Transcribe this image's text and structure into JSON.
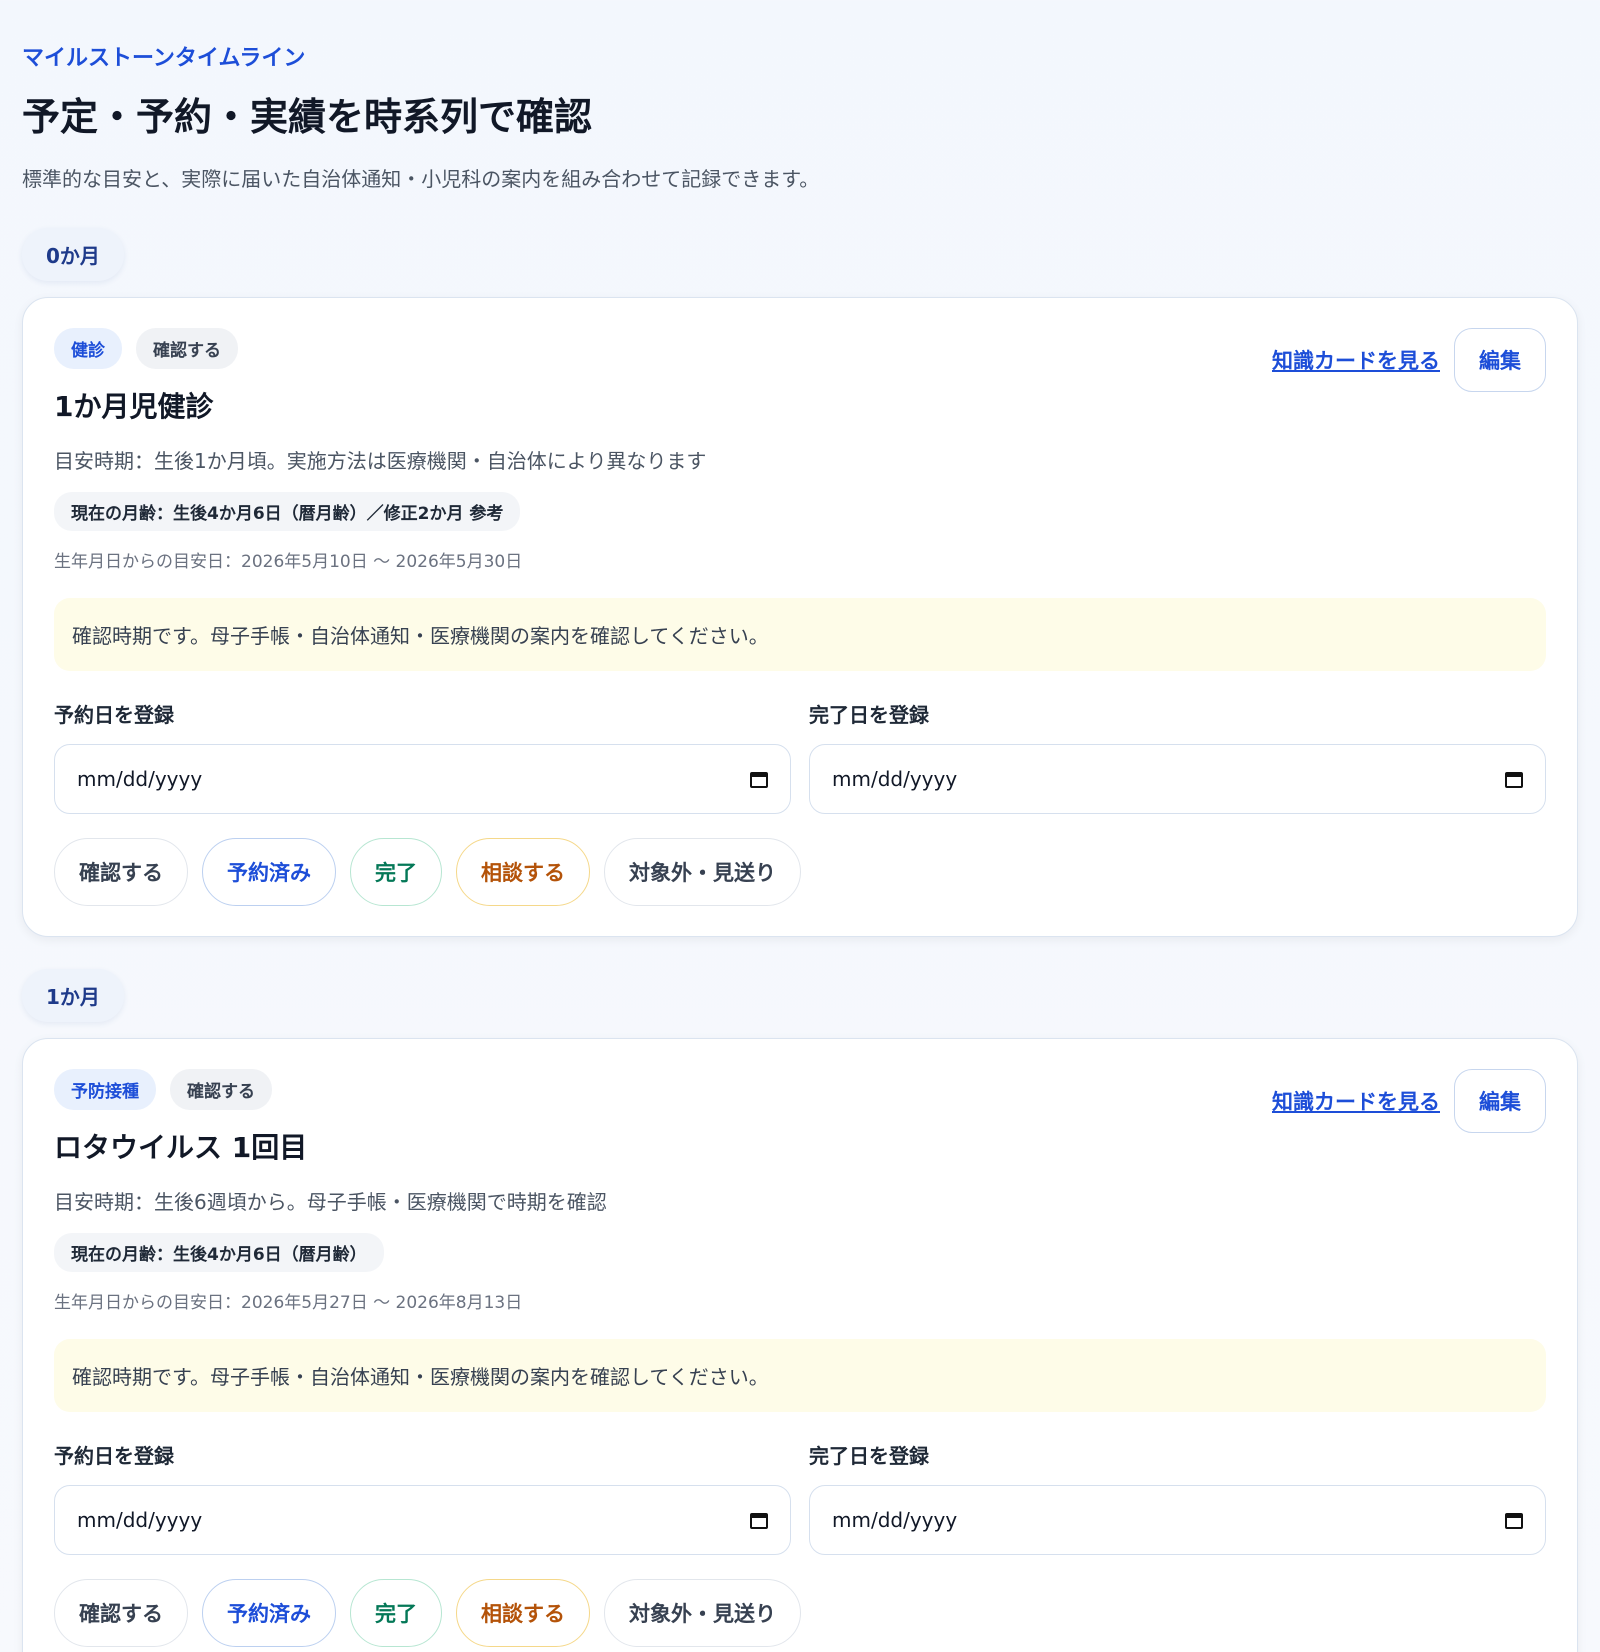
{
  "header": {
    "eyebrow": "マイルストーンタイムライン",
    "title": "予定・予約・実績を時系列で確認",
    "description": "標準的な目安と、実際に届いた自治体通知・小児科の案内を組み合わせて記録できます。"
  },
  "common": {
    "knowledge_link": "知識カードを見る",
    "edit_label": "編集",
    "reserve_label": "予約日を登録",
    "complete_label": "完了日を登録",
    "date_placeholder": "mm/dd/yyyy",
    "actions": {
      "confirm": "確認する",
      "reserved": "予約済み",
      "done": "完了",
      "consult": "相談する",
      "na": "対象外・見送り"
    }
  },
  "sections": [
    {
      "month": "0か月",
      "card": {
        "kind_tag": "健診",
        "status_tag": "確認する",
        "title": "1か月児健診",
        "guide": "目安時期：生後1か月頃。実施方法は医療機関・自治体により異なります",
        "age": "現在の月齢：生後4か月6日（暦月齢）／修正2か月 参考",
        "range": "生年月日からの目安日：2026年5月10日 〜 2026年5月30日",
        "notice": "確認時期です。母子手帳・自治体通知・医療機関の案内を確認してください。"
      }
    },
    {
      "month": "1か月",
      "card": {
        "kind_tag": "予防接種",
        "status_tag": "確認する",
        "title": "ロタウイルス 1回目",
        "guide": "目安時期：生後6週頃から。母子手帳・医療機関で時期を確認",
        "age": "現在の月齢：生後4か月6日（暦月齢）",
        "range": "生年月日からの目安日：2026年5月27日 〜 2026年8月13日",
        "notice": "確認時期です。母子手帳・自治体通知・医療機関の案内を確認してください。"
      }
    }
  ],
  "colors": {
    "accent": "#1d4ed8",
    "notice_bg": "#fefce8",
    "done": "#047857",
    "consult": "#b45309"
  }
}
